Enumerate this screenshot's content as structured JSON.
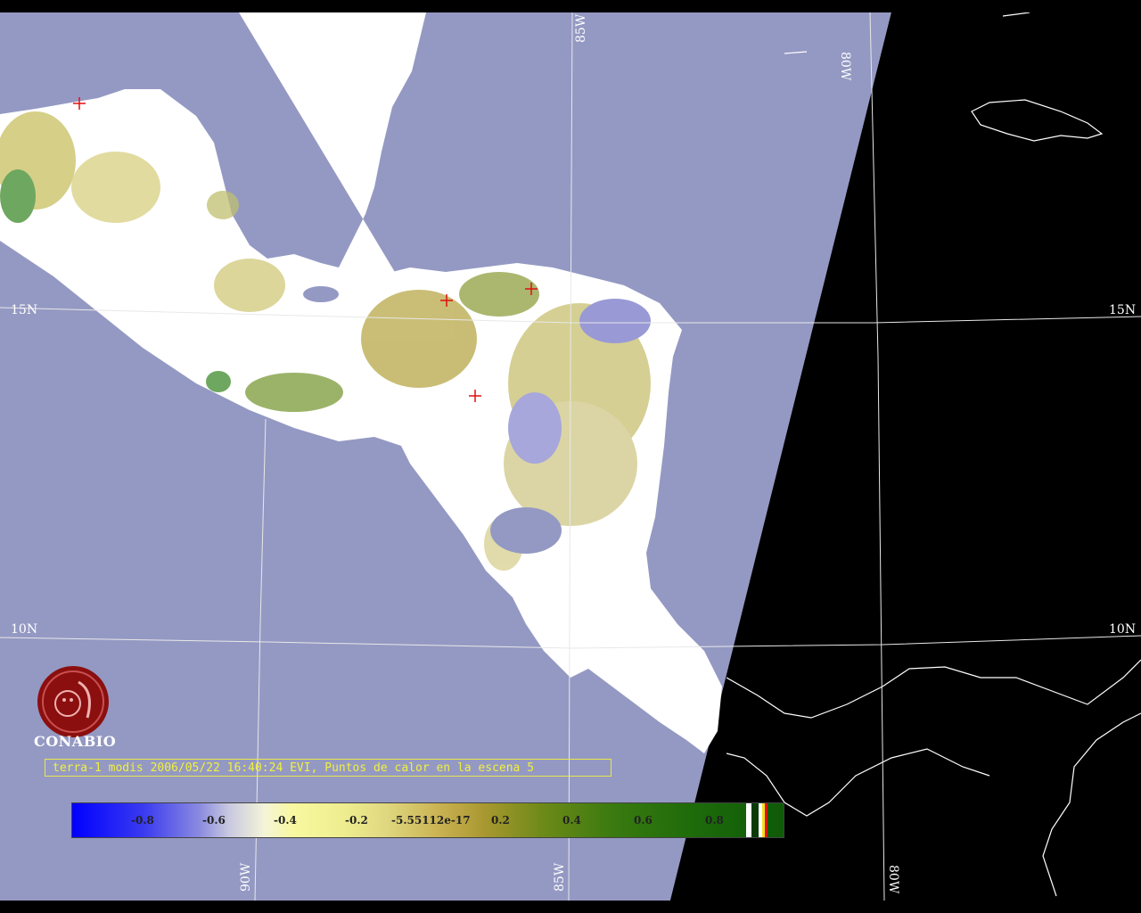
{
  "map": {
    "lat_labels": [
      "15N",
      "10N"
    ],
    "lon_labels": [
      "85W",
      "80W",
      "90W"
    ]
  },
  "caption": "terra-1 modis 2006/05/22 16:40:24 EVI, Puntos de calor en la escena 5",
  "colorbar": {
    "ticks": [
      "-0.8",
      "-0.6",
      "-0.4",
      "-0.2",
      "-5.55112e-17",
      "0.2",
      "0.4",
      "0.6",
      "0.8"
    ]
  },
  "logo": {
    "text": "CONABIO",
    "icon": "conabio-logo-icon",
    "color": "#8b0f0f"
  },
  "colors": {
    "ocean": "#9499c3",
    "land": "#ffffff",
    "night": "#000000",
    "grid": "#e8e8e8",
    "hotspot": "#e01010"
  }
}
